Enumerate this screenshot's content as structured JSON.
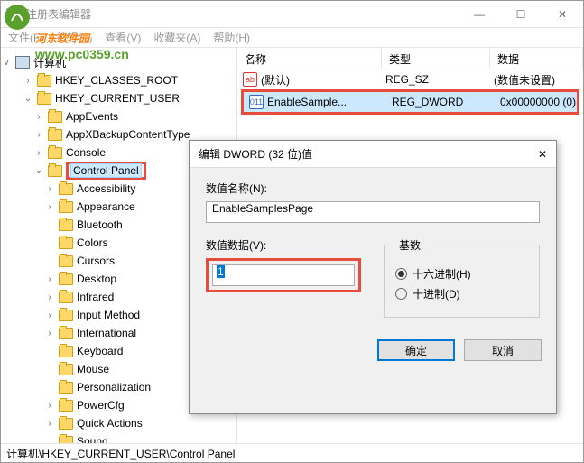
{
  "window": {
    "title": "注册表编辑器",
    "min": "—",
    "max": "☐",
    "close": "✕"
  },
  "menubar": {
    "file": "文件(F)",
    "edit": "编辑(E)",
    "view": "查看(V)",
    "favorites": "收藏夹(A)",
    "help": "帮助(H)"
  },
  "watermark": {
    "name": "河东软件园",
    "url": "www.pc0359.cn"
  },
  "tree": {
    "root": "计算机",
    "items": [
      {
        "label": "HKEY_CLASSES_ROOT",
        "indent": 2,
        "exp": ">"
      },
      {
        "label": "HKEY_CURRENT_USER",
        "indent": 2,
        "exp": "v"
      },
      {
        "label": "AppEvents",
        "indent": 3,
        "exp": ">"
      },
      {
        "label": "AppXBackupContentType",
        "indent": 3,
        "exp": ">"
      },
      {
        "label": "Console",
        "indent": 3,
        "exp": ">"
      },
      {
        "label": "Control Panel",
        "indent": 3,
        "exp": "v",
        "selected": true,
        "highlight": true
      },
      {
        "label": "Accessibility",
        "indent": 4,
        "exp": ">"
      },
      {
        "label": "Appearance",
        "indent": 4,
        "exp": ">"
      },
      {
        "label": "Bluetooth",
        "indent": 4,
        "exp": ""
      },
      {
        "label": "Colors",
        "indent": 4,
        "exp": ""
      },
      {
        "label": "Cursors",
        "indent": 4,
        "exp": ""
      },
      {
        "label": "Desktop",
        "indent": 4,
        "exp": ">"
      },
      {
        "label": "Infrared",
        "indent": 4,
        "exp": ">"
      },
      {
        "label": "Input Method",
        "indent": 4,
        "exp": ">"
      },
      {
        "label": "International",
        "indent": 4,
        "exp": ">"
      },
      {
        "label": "Keyboard",
        "indent": 4,
        "exp": ""
      },
      {
        "label": "Mouse",
        "indent": 4,
        "exp": ""
      },
      {
        "label": "Personalization",
        "indent": 4,
        "exp": ""
      },
      {
        "label": "PowerCfg",
        "indent": 4,
        "exp": ">"
      },
      {
        "label": "Quick Actions",
        "indent": 4,
        "exp": ">"
      },
      {
        "label": "Sound",
        "indent": 4,
        "exp": ""
      }
    ]
  },
  "list": {
    "headers": {
      "name": "名称",
      "type": "类型",
      "data": "数据"
    },
    "rows": [
      {
        "icon": "sz",
        "iconTxt": "ab",
        "name": "(默认)",
        "type": "REG_SZ",
        "data": "(数值未设置)"
      },
      {
        "icon": "dw",
        "iconTxt": "011",
        "name": "EnableSample...",
        "type": "REG_DWORD",
        "data": "0x00000000 (0)",
        "selected": true,
        "highlight": true
      }
    ]
  },
  "statusbar": {
    "path": "计算机\\HKEY_CURRENT_USER\\Control Panel"
  },
  "dialog": {
    "title": "编辑 DWORD (32 位)值",
    "close": "✕",
    "name_label": "数值名称(N):",
    "name_value": "EnableSamplesPage",
    "value_label": "数值数据(V):",
    "value_value": "1",
    "base_label": "基数",
    "radio_hex": "十六进制(H)",
    "radio_dec": "十进制(D)",
    "ok": "确定",
    "cancel": "取消"
  }
}
